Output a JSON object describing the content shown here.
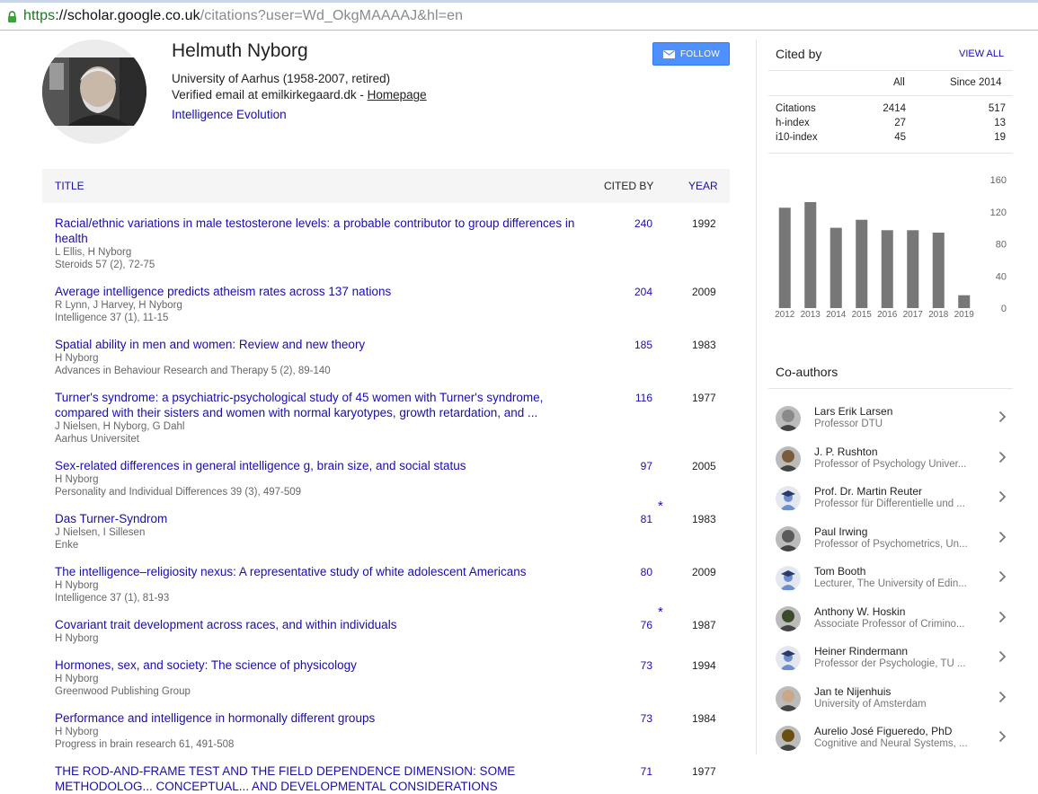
{
  "browser": {
    "url_proto": "https",
    "url_host": "://scholar.google.co.uk",
    "url_path": "/citations?user=Wd_OkgMAAAAJ&hl=en"
  },
  "profile": {
    "name": "Helmuth Nyborg",
    "affiliation": "University of Aarhus (1958-2007, retired)",
    "verified_prefix": "Verified email at emilkirkegaard.dk - ",
    "homepage_label": "Homepage",
    "interests": "Intelligence Evolution",
    "follow_label": "FOLLOW"
  },
  "table": {
    "headers": {
      "title": "TITLE",
      "cited_by": "CITED BY",
      "year": "YEAR"
    },
    "rows": [
      {
        "title": "Racial/ethnic variations in male testosterone levels: a probable contributor to group differences in health",
        "authors": "L Ellis, H Nyborg",
        "venue": "Steroids 57 (2), 72-75",
        "cited": "240",
        "star": "",
        "year": "1992"
      },
      {
        "title": "Average intelligence predicts atheism rates across 137 nations",
        "authors": "R Lynn, J Harvey, H Nyborg",
        "venue": "Intelligence 37 (1), 11-15",
        "cited": "204",
        "star": "",
        "year": "2009"
      },
      {
        "title": "Spatial ability in men and women: Review and new theory",
        "authors": "H Nyborg",
        "venue": "Advances in Behaviour Research and Therapy 5 (2), 89-140",
        "cited": "185",
        "star": "",
        "year": "1983"
      },
      {
        "title": "Turner's syndrome: a psychiatric-psychological study of 45 women with Turner's syndrome, compared with their sisters and women with normal karyotypes, growth retardation, and ...",
        "authors": "J Nielsen, H Nyborg, G Dahl",
        "venue": "Aarhus Universitet",
        "cited": "116",
        "star": "",
        "year": "1977"
      },
      {
        "title": "Sex-related differences in general intelligence g, brain size, and social status",
        "authors": "H Nyborg",
        "venue": "Personality and Individual Differences 39 (3), 497-509",
        "cited": "97",
        "star": "",
        "year": "2005"
      },
      {
        "title": "Das Turner-Syndrom",
        "authors": "J Nielsen, I Sillesen",
        "venue": "Enke",
        "cited": "81",
        "star": "*",
        "year": "1983"
      },
      {
        "title": "The intelligence–religiosity nexus: A representative study of white adolescent Americans",
        "authors": "H Nyborg",
        "venue": "Intelligence 37 (1), 81-93",
        "cited": "80",
        "star": "",
        "year": "2009"
      },
      {
        "title": "Covariant trait development across races, and within individuals",
        "authors": "H Nyborg",
        "venue": "",
        "cited": "76",
        "star": "*",
        "year": "1987"
      },
      {
        "title": "Hormones, sex, and society: The science of physicology",
        "authors": "H Nyborg",
        "venue": "Greenwood Publishing Group",
        "cited": "73",
        "star": "",
        "year": "1994"
      },
      {
        "title": "Performance and intelligence in hormonally different groups",
        "authors": "H Nyborg",
        "venue": "Progress in brain research 61, 491-508",
        "cited": "73",
        "star": "",
        "year": "1984"
      },
      {
        "title": "THE ROD-AND-FRAME TEST AND THE FIELD DEPENDENCE DIMENSION: SOME METHODOLOG... CONCEPTUAL... AND DEVELOPMENTAL CONSIDERATIONS",
        "authors": "",
        "venue": "",
        "cited": "71",
        "star": "",
        "year": "1977"
      }
    ]
  },
  "cited_by": {
    "title": "Cited by",
    "view_all": "VIEW ALL",
    "col_all": "All",
    "col_since": "Since 2014",
    "metrics": [
      {
        "label": "Citations",
        "all": "2414",
        "since": "517"
      },
      {
        "label": "h-index",
        "all": "27",
        "since": "13"
      },
      {
        "label": "i10-index",
        "all": "45",
        "since": "19"
      }
    ]
  },
  "chart_data": {
    "type": "bar",
    "categories": [
      "2012",
      "2013",
      "2014",
      "2015",
      "2016",
      "2017",
      "2018",
      "2019"
    ],
    "values": [
      125,
      132,
      100,
      110,
      97,
      97,
      94,
      16
    ],
    "ylim": [
      0,
      160
    ],
    "yticks": [
      "160",
      "120",
      "80",
      "40",
      "0"
    ],
    "bar_color": "#777777"
  },
  "coauthors": {
    "title": "Co-authors",
    "items": [
      {
        "name": "Lars Erik Larsen",
        "affiliation": "Professor DTU",
        "avatar": "photo"
      },
      {
        "name": "J. P. Rushton",
        "affiliation": "Professor of Psychology Univer...",
        "avatar": "photo"
      },
      {
        "name": "Prof. Dr. Martin Reuter",
        "affiliation": "Professor für Differentielle und ...",
        "avatar": "placeholder"
      },
      {
        "name": "Paul Irwing",
        "affiliation": "Professor of Psychometrics, Un...",
        "avatar": "photo"
      },
      {
        "name": "Tom Booth",
        "affiliation": "Lecturer, The University of Edin...",
        "avatar": "placeholder"
      },
      {
        "name": "Anthony W. Hoskin",
        "affiliation": "Associate Professor of Crimino...",
        "avatar": "photo"
      },
      {
        "name": "Heiner Rindermann",
        "affiliation": "Professor der Psychologie, TU ...",
        "avatar": "placeholder"
      },
      {
        "name": "Jan te Nijenhuis",
        "affiliation": "University of Amsterdam",
        "avatar": "photo"
      },
      {
        "name": "Aurelio José Figueredo, PhD",
        "affiliation": "Cognitive and Neural Systems, ...",
        "avatar": "photo"
      }
    ]
  },
  "colors": {
    "link": "#1a0dab",
    "follow": "#4d90fe"
  }
}
